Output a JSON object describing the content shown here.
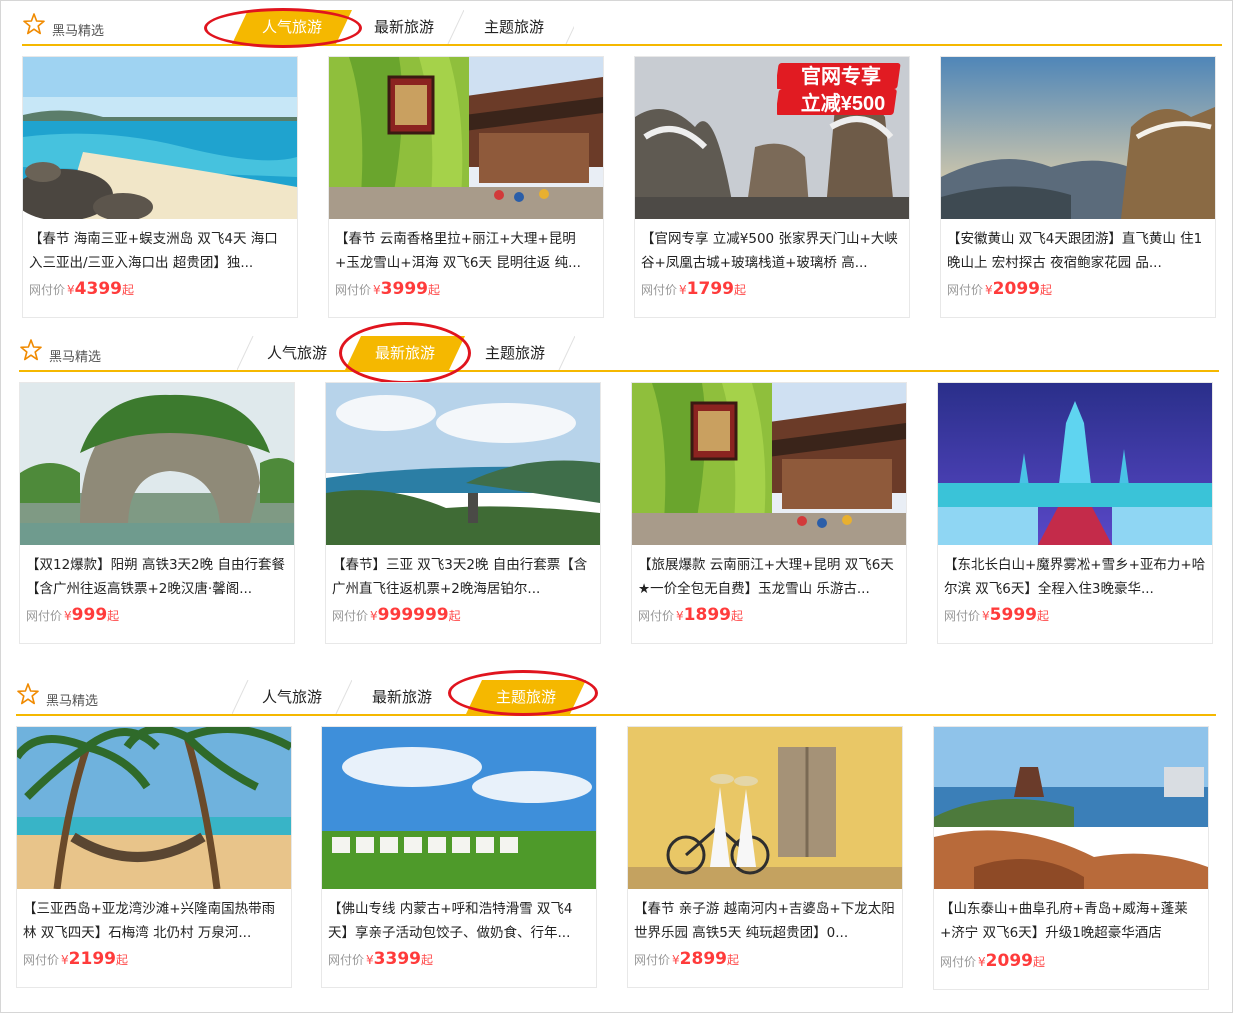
{
  "colors": {
    "accent": "#f5b800",
    "price": "#ff3b3b",
    "annotation_ring": "#e0141e"
  },
  "sections": [
    {
      "brand": "黑马精选",
      "tabs": [
        "人气旅游",
        "最新旅游",
        "主题旅游"
      ],
      "active_tab": "人气旅游",
      "cards": [
        {
          "image": "beach-island-photo",
          "title": "【春节 海南三亚+蜈支洲岛 双飞4天 海口入三亚出/三亚入海口出 超贵团】独...",
          "price_label": "网付价",
          "currency": "¥",
          "price": "4399",
          "suffix": "起"
        },
        {
          "image": "lijiang-old-town-photo",
          "title": "【春节 云南香格里拉+丽江+大理+昆明+玉龙雪山+洱海 双飞6天 昆明往返 纯...",
          "price_label": "网付价",
          "currency": "¥",
          "price": "3999",
          "suffix": "起"
        },
        {
          "image": "zhangjiajie-mountains-photo",
          "badge_line1": "官网专享",
          "badge_line2": "立减¥500",
          "title": "【官网专享 立减¥500 张家界天门山+大峡谷+凤凰古城+玻璃栈道+玻璃桥 高...",
          "price_label": "网付价",
          "currency": "¥",
          "price": "1799",
          "suffix": "起"
        },
        {
          "image": "huangshan-mountain-photo",
          "title": "【安徽黄山 双飞4天跟团游】直飞黄山 住1晚山上 宏村探古 夜宿鲍家花园 品...",
          "price_label": "网付价",
          "currency": "¥",
          "price": "2099",
          "suffix": "起"
        }
      ]
    },
    {
      "brand": "黑马精选",
      "tabs": [
        "人气旅游",
        "最新旅游",
        "主题旅游"
      ],
      "active_tab": "最新旅游",
      "cards": [
        {
          "image": "elephant-trunk-hill-photo",
          "title": "【双12爆款】阳朔 高铁3天2晚 自由行套餐【含广州往返高铁票+2晚汉唐·馨阁...",
          "price_label": "网付价",
          "currency": "¥",
          "price": "999",
          "suffix": "起"
        },
        {
          "image": "sanya-bay-photo",
          "title": "【春节】三亚 双飞3天2晚 自由行套票【含广州直飞往返机票+2晚海居铂尔...",
          "price_label": "网付价",
          "currency": "¥",
          "price": "999999",
          "suffix": "起"
        },
        {
          "image": "lijiang-old-town-photo",
          "title": "【旅展爆款 云南丽江+大理+昆明 双飞6天★一价全包无自费】玉龙雪山 乐游古...",
          "price_label": "网付价",
          "currency": "¥",
          "price": "1899",
          "suffix": "起"
        },
        {
          "image": "harbin-ice-castle-photo",
          "title": "【东北长白山+魔界雾凇+雪乡+亚布力+哈尔滨 双飞6天】全程入住3晚豪华...",
          "price_label": "网付价",
          "currency": "¥",
          "price": "5999",
          "suffix": "起"
        }
      ]
    },
    {
      "brand": "黑马精选",
      "tabs": [
        "人气旅游",
        "最新旅游",
        "主题旅游"
      ],
      "active_tab": "主题旅游",
      "cards": [
        {
          "image": "palm-beach-hammock-photo",
          "title": "【三亚西岛+亚龙湾沙滩+兴隆南国热带雨林 双飞四天】石梅湾 北仍村 万泉河...",
          "price_label": "网付价",
          "currency": "¥",
          "price": "2199",
          "suffix": "起"
        },
        {
          "image": "inner-mongolia-yurts-photo",
          "title": "【佛山专线 内蒙古+呼和浩特滑雪 双飞4天】享亲子活动包饺子、做奶食、行年...",
          "price_label": "网付价",
          "currency": "¥",
          "price": "3399",
          "suffix": "起"
        },
        {
          "image": "vietnam-bicycle-girls-photo",
          "title": "【春节 亲子游 越南河内+吉婆岛+下龙太阳世界乐园 高铁5天 纯玩超贵团】0...",
          "price_label": "网付价",
          "currency": "¥",
          "price": "2899",
          "suffix": "起"
        },
        {
          "image": "shandong-coast-photo",
          "title": "【山东泰山+曲阜孔府+青岛+威海+蓬莱+济宁 双飞6天】升级1晚超豪华酒店",
          "price_label": "网付价",
          "currency": "¥",
          "price": "2099",
          "suffix": "起"
        }
      ]
    }
  ]
}
